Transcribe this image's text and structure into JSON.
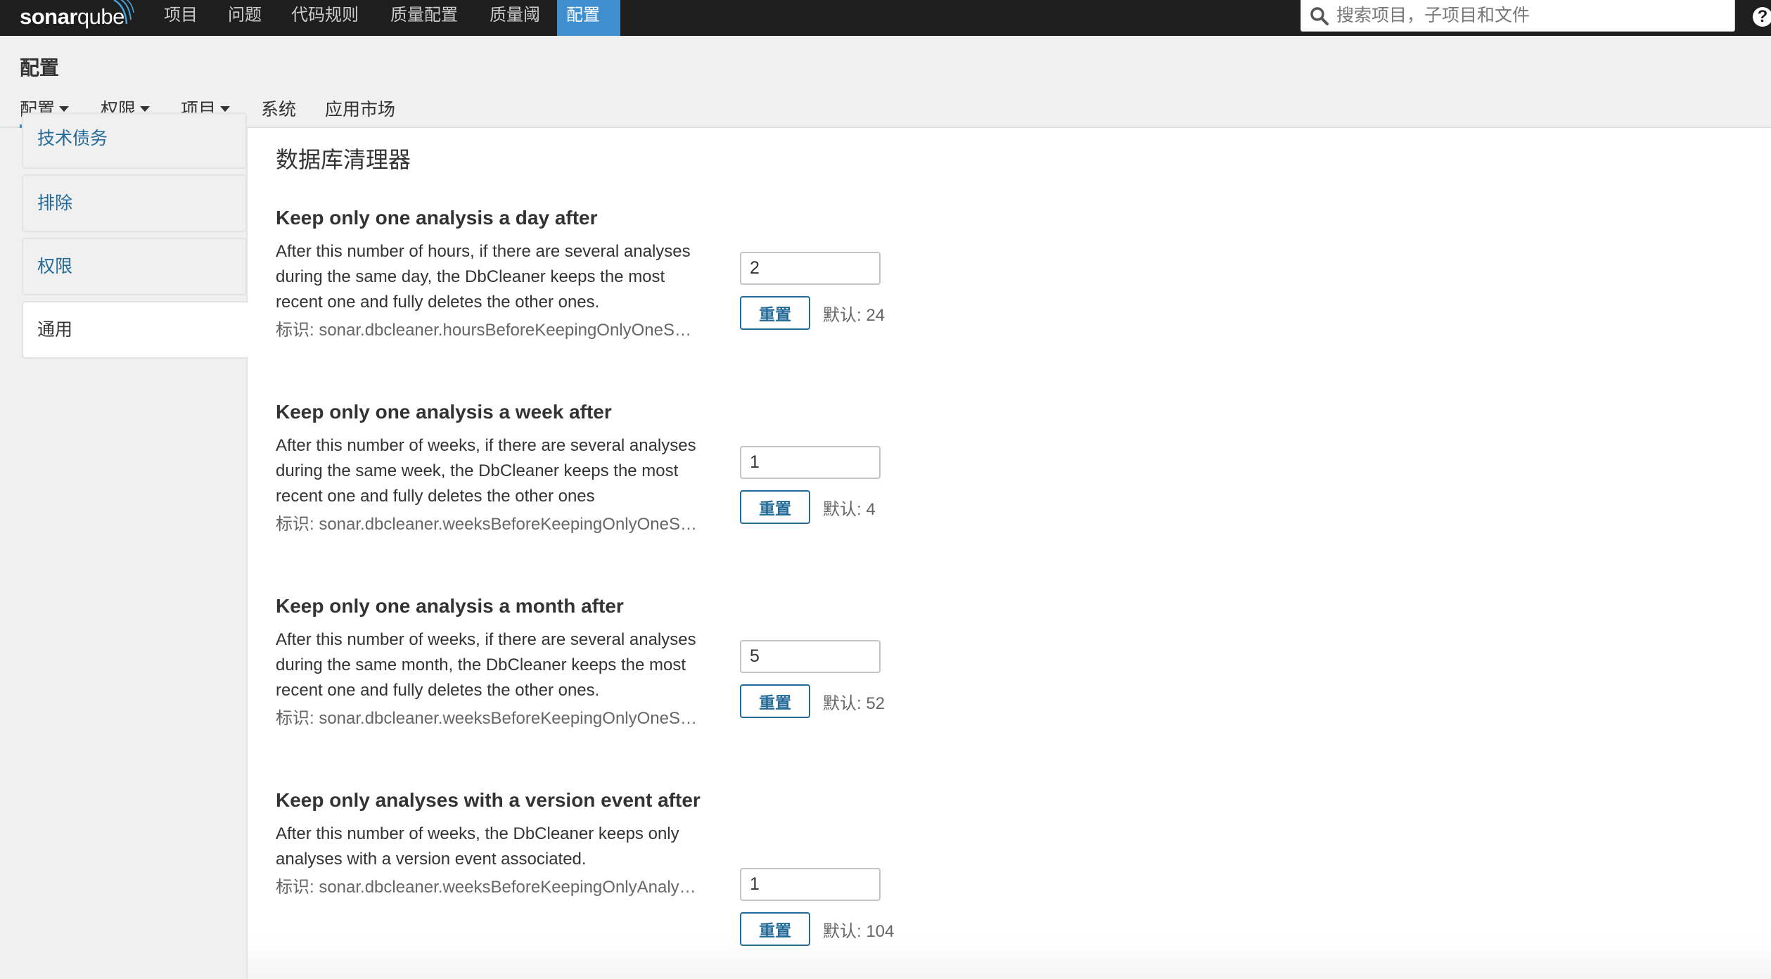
{
  "topbar": {
    "logo_bold": "sonar",
    "logo_light": "qube",
    "nav": [
      {
        "label": "项目",
        "active": false
      },
      {
        "label": "问题",
        "active": false
      },
      {
        "label": "代码规则",
        "active": false
      },
      {
        "label": "质量配置",
        "active": false
      },
      {
        "label": "质量阈",
        "active": false
      },
      {
        "label": "配置",
        "active": true
      }
    ],
    "search_placeholder": "搜索项目，子项目和文件",
    "help_label": "?",
    "accent": "#3f8fcf",
    "bg": "#1e1e1e"
  },
  "page": {
    "title": "配置",
    "subnav": [
      {
        "label": "配置",
        "dropdown": true,
        "active": true
      },
      {
        "label": "权限",
        "dropdown": true,
        "active": false
      },
      {
        "label": "项目",
        "dropdown": true,
        "active": false
      },
      {
        "label": "系统",
        "dropdown": false,
        "active": false
      },
      {
        "label": "应用市场",
        "dropdown": false,
        "active": false
      }
    ]
  },
  "sidebar": {
    "items": [
      {
        "label": "技术债务",
        "active": false
      },
      {
        "label": "排除",
        "active": false
      },
      {
        "label": "权限",
        "active": false
      },
      {
        "label": "通用",
        "active": true
      }
    ]
  },
  "main": {
    "section_title": "数据库清理器",
    "reset_label": "重置",
    "settings": [
      {
        "title": "Keep only one analysis a day after",
        "description": "After this number of hours, if there are several analyses during the same day, the DbCleaner keeps the most recent one and fully deletes the other ones.",
        "key": "标识: sonar.dbcleaner.hoursBeforeKeepingOnlyOneS…",
        "value": "2",
        "default": "默认: 24"
      },
      {
        "title": "Keep only one analysis a week after",
        "description": "After this number of weeks, if there are several analyses during the same week, the DbCleaner keeps the most recent one and fully deletes the other ones",
        "key": "标识: sonar.dbcleaner.weeksBeforeKeepingOnlyOneS…",
        "value": "1",
        "default": "默认: 4"
      },
      {
        "title": "Keep only one analysis a month after",
        "description": "After this number of weeks, if there are several analyses during the same month, the DbCleaner keeps the most recent one and fully deletes the other ones.",
        "key": "标识: sonar.dbcleaner.weeksBeforeKeepingOnlyOneS…",
        "value": "5",
        "default": "默认: 52"
      },
      {
        "title": "Keep only analyses with a version event after",
        "description": "After this number of weeks, the DbCleaner keeps only analyses with a version event associated.",
        "key": "标识: sonar.dbcleaner.weeksBeforeKeepingOnlyAnaly…",
        "value": "1",
        "default": "默认: 104"
      }
    ]
  }
}
